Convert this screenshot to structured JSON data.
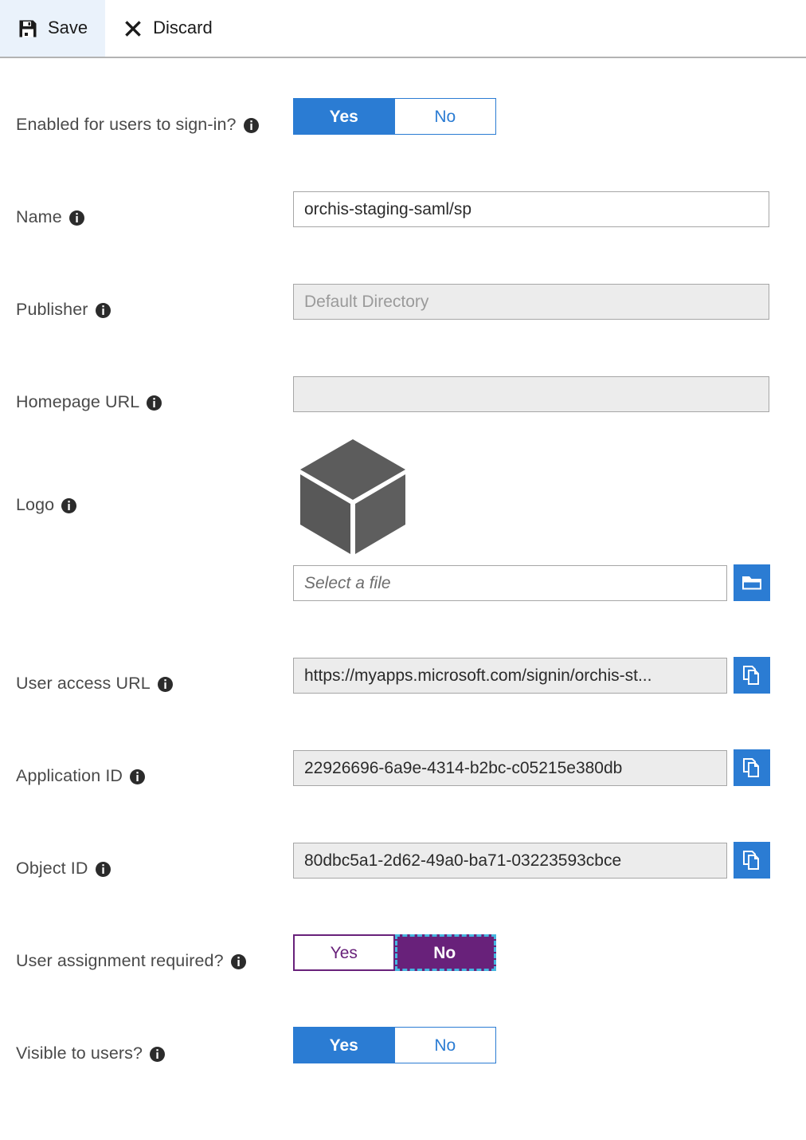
{
  "toolbar": {
    "save_label": "Save",
    "save_icon": "save-floppy-icon",
    "discard_label": "Discard",
    "discard_icon": "close-x-icon"
  },
  "theme": {
    "accent_blue": "#2b7cd3",
    "accent_purple": "#68217a",
    "focus_outline": "#45b6e0",
    "readonly_bg": "#ececec",
    "label_color": "#4a4a4a",
    "toolbar_hover_bg": "#eaf2fb"
  },
  "form": {
    "rows": [
      {
        "label": "Enabled for users to sign-in?",
        "type": "toggle",
        "style": "blue",
        "options": [
          "Yes",
          "No"
        ],
        "selected": "Yes"
      },
      {
        "label": "Name",
        "type": "text",
        "value": "orchis-staging-saml/sp",
        "readonly": false
      },
      {
        "label": "Publisher",
        "type": "text",
        "value": "Default Directory",
        "readonly": true
      },
      {
        "label": "Homepage URL",
        "type": "text",
        "value": "",
        "readonly": true
      },
      {
        "label": "Logo",
        "type": "logo",
        "logo_icon": "cube-app-logo-icon",
        "file_placeholder": "Select a file",
        "browse_icon": "folder-icon"
      },
      {
        "label": "User access URL",
        "type": "text-copy",
        "value": "https://myapps.microsoft.com/signin/orchis-st...",
        "copy_icon": "copy-icon"
      },
      {
        "label": "Application ID",
        "type": "text-copy",
        "value": "22926696-6a9e-4314-b2bc-c05215e380db",
        "copy_icon": "copy-icon"
      },
      {
        "label": "Object ID",
        "type": "text-copy",
        "value": "80dbc5a1-2d62-49a0-ba71-03223593cbce",
        "copy_icon": "copy-icon"
      },
      {
        "label": "User assignment required?",
        "type": "toggle",
        "style": "purple",
        "options": [
          "Yes",
          "No"
        ],
        "selected": "No"
      },
      {
        "label": "Visible to users?",
        "type": "toggle",
        "style": "blue",
        "options": [
          "Yes",
          "No"
        ],
        "selected": "Yes"
      }
    ]
  }
}
